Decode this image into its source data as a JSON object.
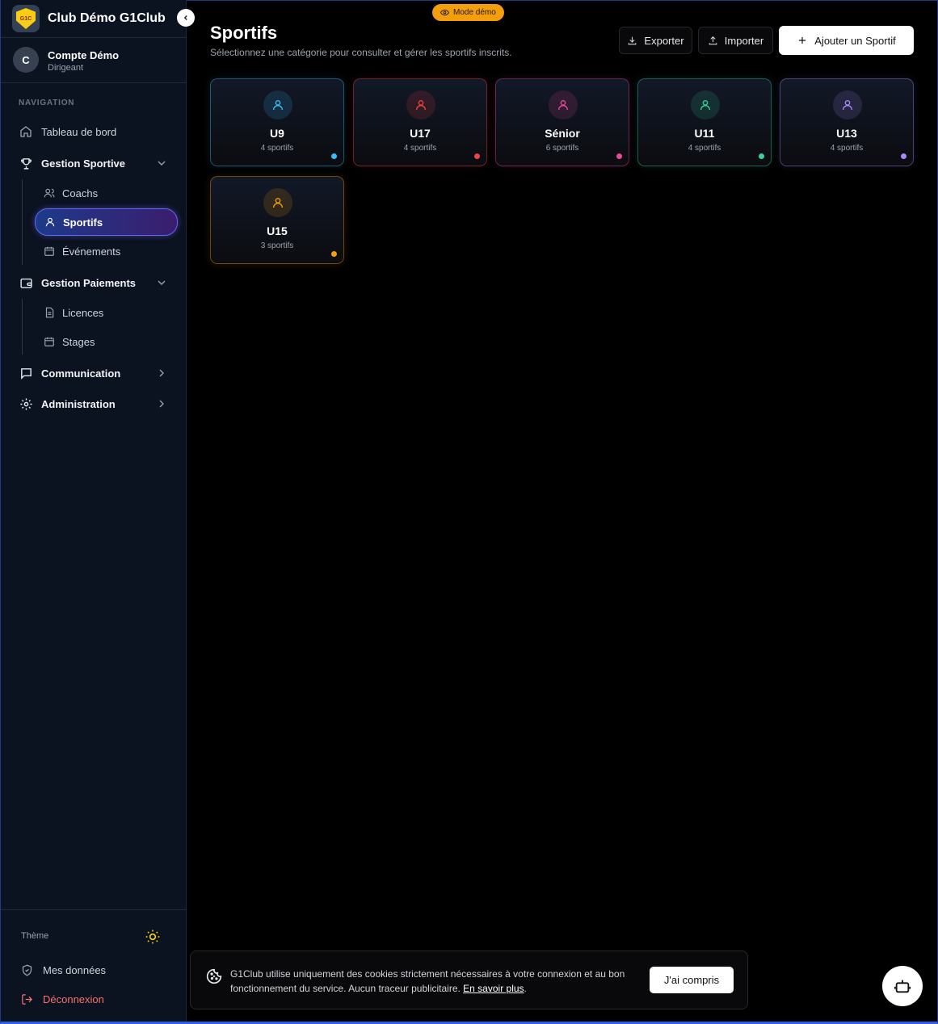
{
  "brand": {
    "title": "Club Démo G1Club",
    "logo_text": "G1C"
  },
  "user": {
    "initial": "C",
    "name": "Compte Démo",
    "role": "Dirigeant"
  },
  "nav": {
    "section_label": "NAVIGATION",
    "dashboard": "Tableau de bord",
    "sport_group": "Gestion Sportive",
    "coachs": "Coachs",
    "sportifs": "Sportifs",
    "events": "Événements",
    "payment_group": "Gestion Paiements",
    "licences": "Licences",
    "stages": "Stages",
    "communication": "Communication",
    "administration": "Administration"
  },
  "sidebar_bottom": {
    "theme_label": "Thème",
    "my_data": "Mes données",
    "logout": "Déconnexion"
  },
  "demo_badge": "Mode démo",
  "header": {
    "title": "Sportifs",
    "subtitle": "Sélectionnez une catégorie pour consulter et gérer les sportifs inscrits.",
    "export_label": "Exporter",
    "import_label": "Importer",
    "add_label": "Ajouter un Sportif"
  },
  "categories": [
    {
      "name": "U9",
      "count": "4 sportifs",
      "color": "#38bdf8"
    },
    {
      "name": "U17",
      "count": "4 sportifs",
      "color": "#ef4444"
    },
    {
      "name": "Sénior",
      "count": "6 sportifs",
      "color": "#ec4899"
    },
    {
      "name": "U11",
      "count": "4 sportifs",
      "color": "#34d399"
    },
    {
      "name": "U13",
      "count": "4 sportifs",
      "color": "#a78bfa"
    },
    {
      "name": "U15",
      "count": "3 sportifs",
      "color": "#f59e0b"
    }
  ],
  "cookie": {
    "text": "G1Club utilise uniquement des cookies strictement nécessaires à votre connexion et au bon fonctionnement du service. Aucun traceur publicitaire. ",
    "link": "En savoir plus",
    "end": ".",
    "button": "J'ai compris"
  }
}
